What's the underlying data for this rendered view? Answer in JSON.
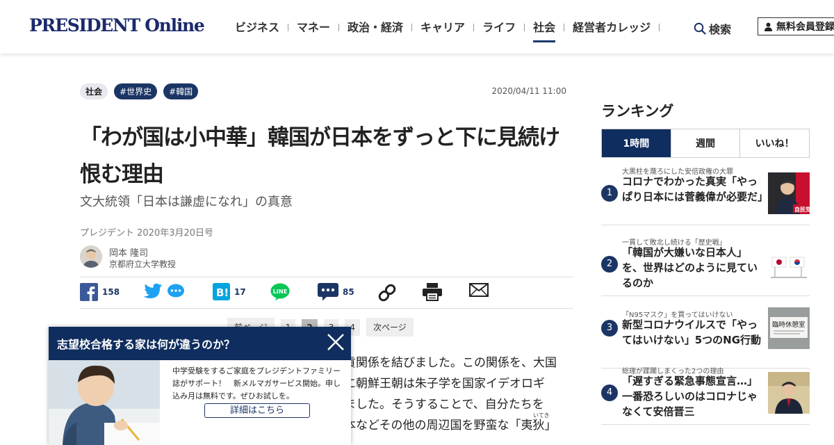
{
  "header": {
    "logo": "PRESIDENT Online",
    "nav": [
      "ビジネス",
      "マネー",
      "政治・経済",
      "キャリア",
      "ライフ",
      "社会",
      "経営者カレッジ"
    ],
    "search_label": "検索",
    "member_label": "無料会員登録"
  },
  "article": {
    "tags": [
      "社会",
      "#世界史",
      "#韓国"
    ],
    "date": "2020/04/11 11:00",
    "title": "「わが国は小中華」韓国が日本をずっと下に見続け恨む理由",
    "subtitle": "文大統領「日本は謙虚になれ」の真意",
    "source": "プレジデント 2020年3月20日号",
    "author_name": "岡本 隆司",
    "author_title": "京都府立大学教授",
    "share": {
      "facebook_count": "158",
      "hatena_count": "17",
      "comment_count": "85"
    },
    "pager": {
      "prev": "前ページ",
      "pages": [
        "1",
        "2",
        "3",
        "4"
      ],
      "next": "次ページ"
    },
    "body_lines": [
      "貢関係を結びました。この関係を、大国",
      "に朝鮮王朝は朱子学を国家イデオロギ",
      "ました。そうすることで、自分たちを",
      "本などその他の周辺国を野蛮な「夷狄」"
    ],
    "ruby": "いてき"
  },
  "popup": {
    "title": "志望校合格する家は何が違うのか？",
    "text": "中学受験をするご家庭をプレジデントファミリー誌がサポート！　新メルマガサービス開始。申し込み月は無料です。ぜひお試しを。",
    "button": "詳細はこちら"
  },
  "ranking": {
    "title": "ランキング",
    "tabs": [
      "1時間",
      "週間",
      "いいね！"
    ],
    "items": [
      {
        "num": "1",
        "kicker": "大黒柱を蔑ろにした安倍政権の大罪",
        "headline": "コロナでわかった真実「やっぱり日本には菅義偉が必要だ」"
      },
      {
        "num": "2",
        "kicker": "一貫して敗北し続ける「歴史戦」",
        "headline": "「韓国が大嫌いな日本人」を、世界はどのように見ているのか"
      },
      {
        "num": "3",
        "kicker": "「N95マスク」を買ってはいけない",
        "headline": "新型コロナウイルスで「やってはいけない」5つのNG行動",
        "thumb_text": "臨時休憩室"
      },
      {
        "num": "4",
        "kicker": "総理が蹂躙しまくった2つの理由",
        "headline": "「遅すぎる緊急事態宣言…」一番恐ろしいのはコロナじゃなくて安倍晋三"
      }
    ]
  },
  "colors": {
    "navy": "#1b3565",
    "popup_navy": "#0f2d5e",
    "line_green": "#06c755",
    "facebook": "#3b5998",
    "twitter": "#1da1f2",
    "hatena": "#00a4de"
  }
}
